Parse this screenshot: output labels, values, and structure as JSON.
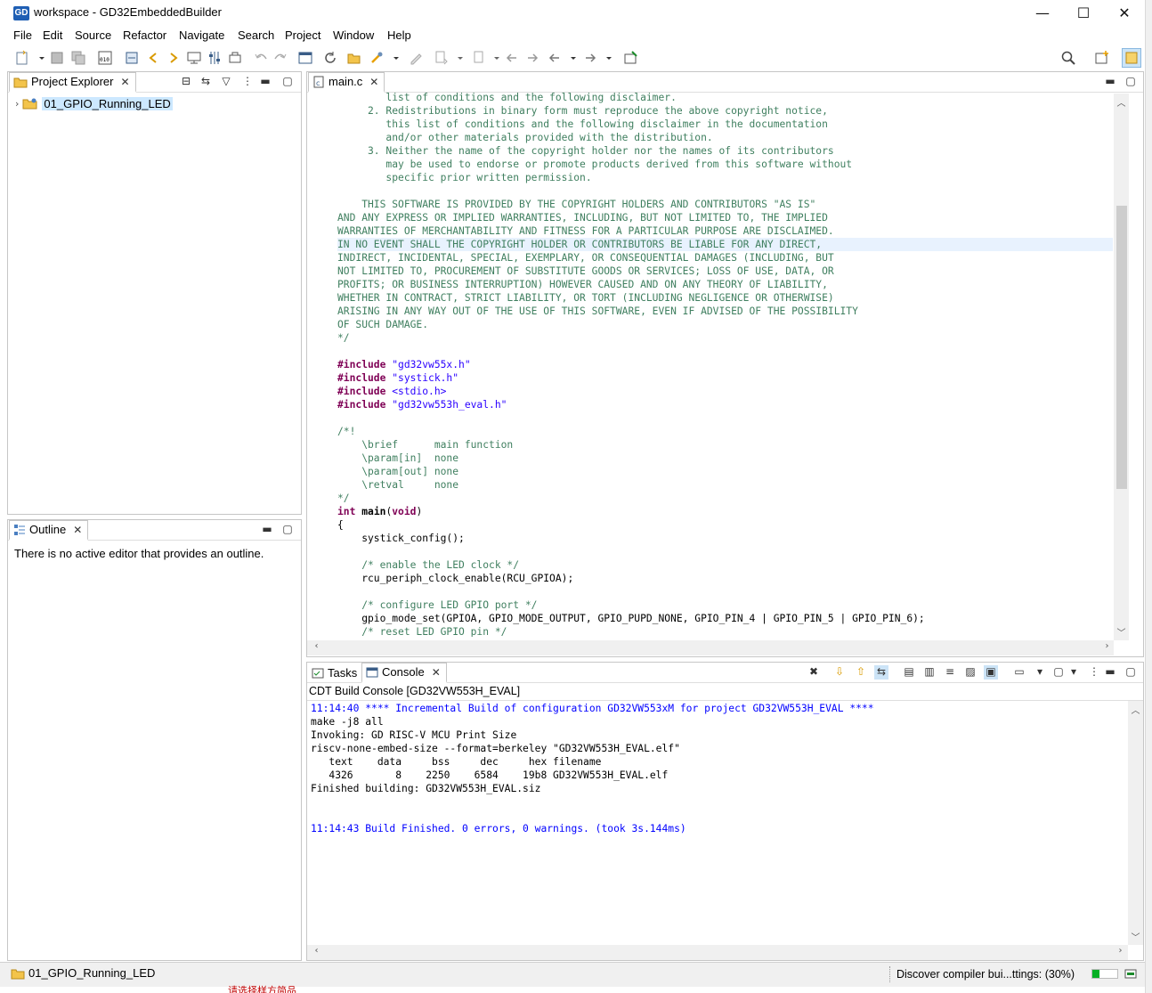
{
  "window": {
    "app_icon_text": "GD",
    "title": "workspace - GD32EmbeddedBuilder",
    "minimize": "—",
    "maximize": "☐",
    "close": "✕"
  },
  "menu": [
    "File",
    "Edit",
    "Source",
    "Refactor",
    "Navigate",
    "Search",
    "Project",
    "Window",
    "Help"
  ],
  "project_explorer": {
    "tab_label": "Project Explorer",
    "project_name": "01_GPIO_Running_LED"
  },
  "outline": {
    "tab_label": "Outline",
    "message": "There is no active editor that provides an outline."
  },
  "editor": {
    "tab_label": "main.c",
    "lines": [
      {
        "t": "        list of conditions and the following disclaimer.",
        "c": "comment"
      },
      {
        "t": "     2. Redistributions in binary form must reproduce the above copyright notice,",
        "c": "comment"
      },
      {
        "t": "        this list of conditions and the following disclaimer in the documentation",
        "c": "comment"
      },
      {
        "t": "        and/or other materials provided with the distribution.",
        "c": "comment"
      },
      {
        "t": "     3. Neither the name of the copyright holder nor the names of its contributors",
        "c": "comment"
      },
      {
        "t": "        may be used to endorse or promote products derived from this software without",
        "c": "comment"
      },
      {
        "t": "        specific prior written permission.",
        "c": "comment"
      },
      {
        "t": "",
        "c": "comment"
      },
      {
        "t": "    THIS SOFTWARE IS PROVIDED BY THE COPYRIGHT HOLDERS AND CONTRIBUTORS \"AS IS\"",
        "c": "comment"
      },
      {
        "t": "AND ANY EXPRESS OR IMPLIED WARRANTIES, INCLUDING, BUT NOT LIMITED TO, THE IMPLIED",
        "c": "comment"
      },
      {
        "t": "WARRANTIES OF MERCHANTABILITY AND FITNESS FOR A PARTICULAR PURPOSE ARE DISCLAIMED.",
        "c": "comment"
      },
      {
        "t": "IN NO EVENT SHALL THE COPYRIGHT HOLDER OR CONTRIBUTORS BE LIABLE FOR ANY DIRECT,",
        "c": "comment",
        "hl": true
      },
      {
        "t": "INDIRECT, INCIDENTAL, SPECIAL, EXEMPLARY, OR CONSEQUENTIAL DAMAGES (INCLUDING, BUT",
        "c": "comment"
      },
      {
        "t": "NOT LIMITED TO, PROCUREMENT OF SUBSTITUTE GOODS OR SERVICES; LOSS OF USE, DATA, OR",
        "c": "comment"
      },
      {
        "t": "PROFITS; OR BUSINESS INTERRUPTION) HOWEVER CAUSED AND ON ANY THEORY OF LIABILITY,",
        "c": "comment"
      },
      {
        "t": "WHETHER IN CONTRACT, STRICT LIABILITY, OR TORT (INCLUDING NEGLIGENCE OR OTHERWISE)",
        "c": "comment"
      },
      {
        "t": "ARISING IN ANY WAY OUT OF THE USE OF THIS SOFTWARE, EVEN IF ADVISED OF THE POSSIBILITY",
        "c": "comment"
      },
      {
        "t": "OF SUCH DAMAGE.",
        "c": "comment"
      },
      {
        "t": "*/",
        "c": "comment"
      },
      {
        "t": "",
        "c": "plain"
      },
      {
        "segs": [
          {
            "t": "#include ",
            "c": "kw"
          },
          {
            "t": "\"gd32vw55x.h\"",
            "c": "str"
          }
        ]
      },
      {
        "segs": [
          {
            "t": "#include ",
            "c": "kw"
          },
          {
            "t": "\"systick.h\"",
            "c": "str"
          }
        ]
      },
      {
        "segs": [
          {
            "t": "#include ",
            "c": "kw"
          },
          {
            "t": "<stdio.h>",
            "c": "str"
          }
        ]
      },
      {
        "segs": [
          {
            "t": "#include ",
            "c": "kw"
          },
          {
            "t": "\"gd32vw553h_eval.h\"",
            "c": "str"
          }
        ]
      },
      {
        "t": "",
        "c": "plain"
      },
      {
        "t": "/*!",
        "c": "comment",
        "fold": true
      },
      {
        "t": "    \\brief      main function",
        "c": "comment"
      },
      {
        "t": "    \\param[in]  none",
        "c": "comment"
      },
      {
        "t": "    \\param[out] none",
        "c": "comment"
      },
      {
        "t": "    \\retval     none",
        "c": "comment"
      },
      {
        "t": "*/",
        "c": "comment"
      },
      {
        "segs": [
          {
            "t": "int ",
            "c": "kw"
          },
          {
            "t": "main",
            "c": "plainb"
          },
          {
            "t": "(",
            "c": "plain"
          },
          {
            "t": "void",
            "c": "kw"
          },
          {
            "t": ")",
            "c": "plain"
          }
        ],
        "fold": true
      },
      {
        "t": "{",
        "c": "plain"
      },
      {
        "t": "    systick_config();",
        "c": "plain"
      },
      {
        "t": "",
        "c": "plain"
      },
      {
        "t": "    /* enable the LED clock */",
        "c": "comment"
      },
      {
        "t": "    rcu_periph_clock_enable(RCU_GPIOA);",
        "c": "plain"
      },
      {
        "t": "",
        "c": "plain"
      },
      {
        "t": "    /* configure LED GPIO port */",
        "c": "comment"
      },
      {
        "t": "    gpio_mode_set(GPIOA, GPIO_MODE_OUTPUT, GPIO_PUPD_NONE, GPIO_PIN_4 | GPIO_PIN_5 | GPIO_PIN_6);",
        "c": "plain"
      },
      {
        "t": "    /* reset LED GPIO pin */",
        "c": "comment"
      }
    ]
  },
  "console": {
    "tasks_tab": "Tasks",
    "console_tab": "Console",
    "header": "CDT Build Console [GD32VW553H_EVAL]",
    "lines": [
      {
        "t": "11:14:40 **** Incremental Build of configuration GD32VW553xM for project GD32VW553H_EVAL ****",
        "blue": true
      },
      {
        "t": "make -j8 all"
      },
      {
        "t": "Invoking: GD RISC-V MCU Print Size"
      },
      {
        "t": "riscv-none-embed-size --format=berkeley \"GD32VW553H_EVAL.elf\""
      },
      {
        "t": "   text    data     bss     dec     hex filename"
      },
      {
        "t": "   4326       8    2250    6584    19b8 GD32VW553H_EVAL.elf"
      },
      {
        "t": "Finished building: GD32VW553H_EVAL.siz"
      },
      {
        "t": ""
      },
      {
        "t": ""
      },
      {
        "t": "11:14:43 Build Finished. 0 errors, 0 warnings. (took 3s.144ms)",
        "blue": true
      }
    ]
  },
  "statusbar": {
    "project": "01_GPIO_Running_LED",
    "task": "Discover compiler bui...ttings: (30%)",
    "progress": 0.3
  },
  "overflow_text": "请选择样方简品"
}
